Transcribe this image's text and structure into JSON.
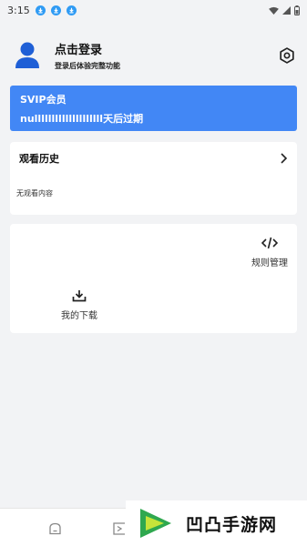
{
  "status": {
    "time": "3:15",
    "download_icons": [
      "download-icon",
      "download-icon",
      "download-icon"
    ],
    "right_icons": [
      "wifi-icon",
      "signal-icon",
      "battery-icon"
    ]
  },
  "profile": {
    "title": "点击登录",
    "subtitle": "登录后体验完整功能",
    "avatar_icon": "person-icon",
    "settings_icon": "settings-icon"
  },
  "vip": {
    "title": "SVIP会员",
    "expire_text": "nullllllllllllllllllll天后过期",
    "color": "#4287f5"
  },
  "history": {
    "title": "观看历史",
    "empty_text": "无观看内容"
  },
  "tools": {
    "rules_label": "规则管理",
    "downloads_label": "我的下载"
  },
  "watermark": {
    "text": "凹凸手游网"
  }
}
